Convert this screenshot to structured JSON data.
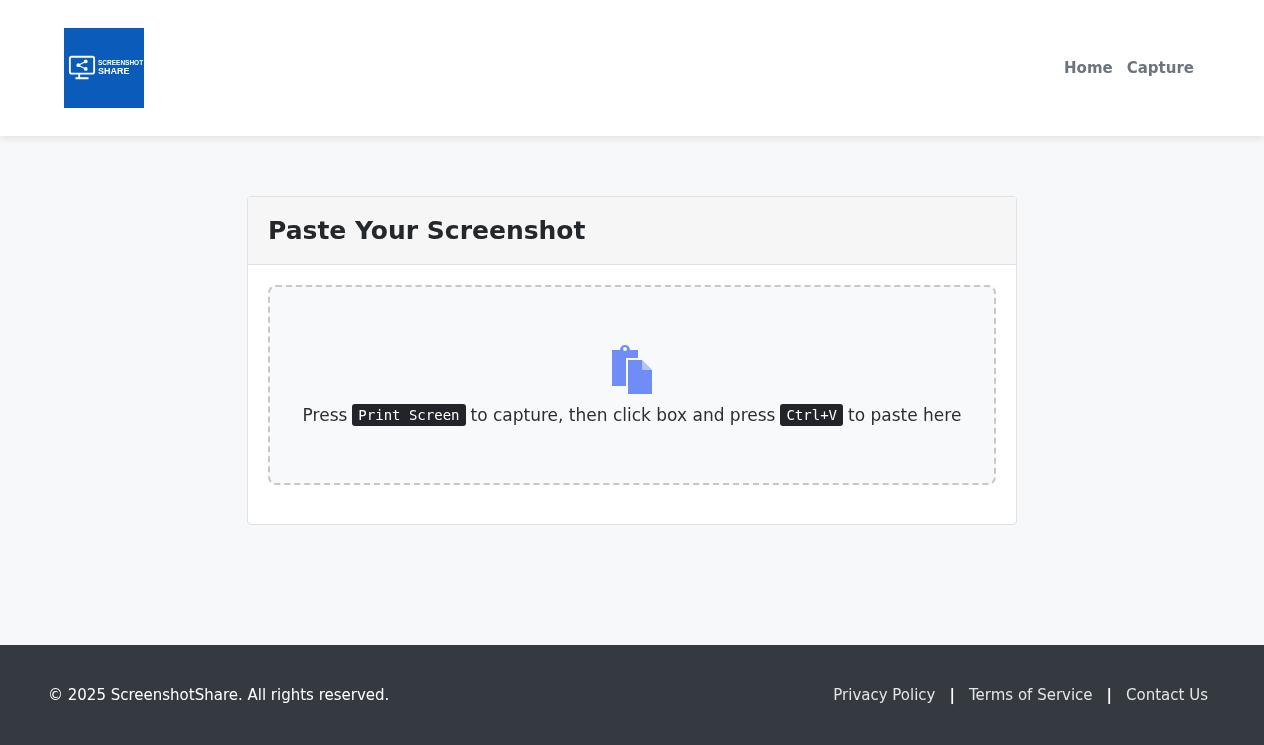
{
  "header": {
    "logo": {
      "line_1": "SCREENSHOT",
      "line_2": "SHARE"
    },
    "nav": [
      {
        "label": "Home"
      },
      {
        "label": "Capture"
      }
    ]
  },
  "card": {
    "title": "Paste Your Screenshot",
    "instruction": [
      {
        "kind": "text",
        "text": "Press"
      },
      {
        "kind": "key",
        "text": "Print Screen"
      },
      {
        "kind": "text",
        "text": "to capture, then click box and press"
      },
      {
        "kind": "key",
        "text": "Ctrl+V"
      },
      {
        "kind": "text",
        "text": "to paste here"
      }
    ]
  },
  "footer": {
    "copyright": "© 2025 ScreenshotShare. All rights reserved.",
    "links": [
      {
        "label": "Privacy Policy"
      },
      {
        "label": "Terms of Service"
      },
      {
        "label": "Contact Us"
      }
    ],
    "separator": "|"
  }
}
